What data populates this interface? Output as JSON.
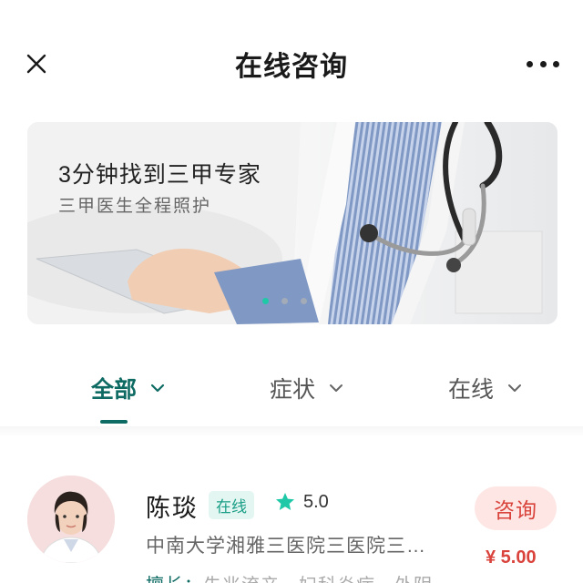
{
  "header": {
    "title": "在线咨询",
    "close_icon": "close-icon",
    "more_icon": "more-horizontal-icon"
  },
  "banner": {
    "title": "3分钟找到三甲专家",
    "subtitle": "三甲医生全程照护",
    "active_dot_color": "#1fc9a8",
    "dot_count": 3,
    "active_dot": 0
  },
  "filters": [
    {
      "label": "全部",
      "active": true
    },
    {
      "label": "症状",
      "active": false
    },
    {
      "label": "在线",
      "active": false
    }
  ],
  "doctor": {
    "name": "陈琰",
    "status": "在线",
    "rating": "5.0",
    "hospital": "中南大学湘雅三医院三医院三…",
    "specialty_label": "擅长：",
    "specialty_text": "先兆流产、妇科炎症、外阴",
    "consult_label": "咨询",
    "price": "¥ 5.00"
  },
  "colors": {
    "accent": "#0e6b63",
    "online_badge": "#1a9e86",
    "star": "#1fc9a8",
    "price": "#d9433b"
  }
}
